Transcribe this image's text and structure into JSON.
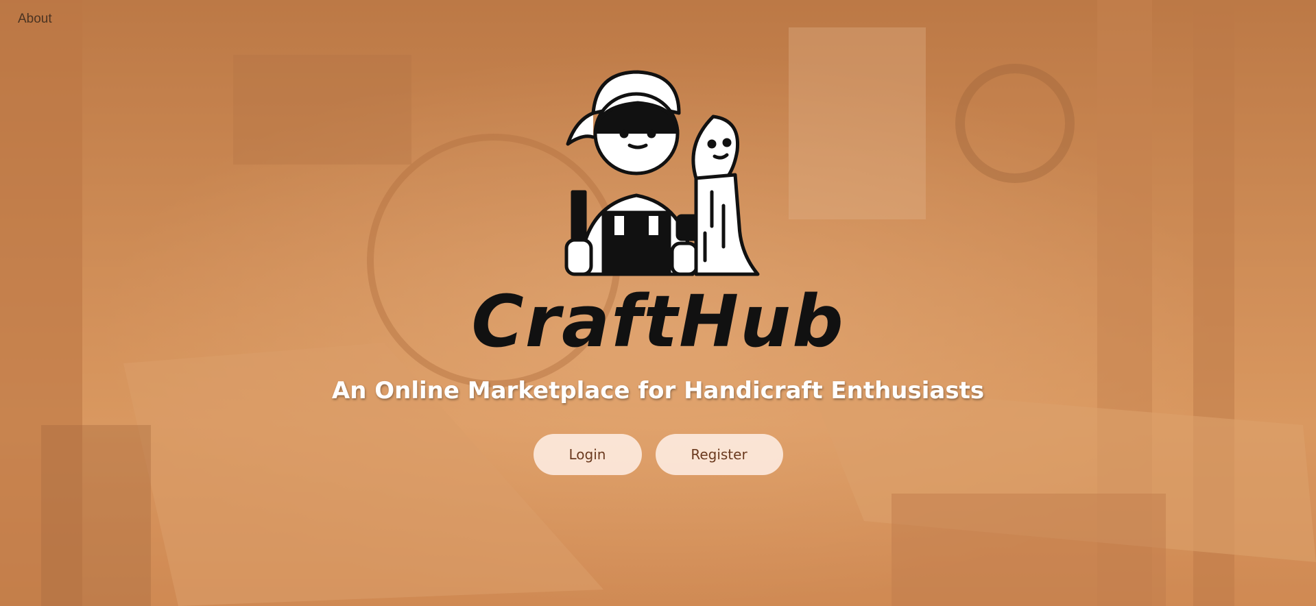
{
  "nav": {
    "about_label": "About"
  },
  "brand": {
    "name": "CraftHub",
    "logo_icon": "craftsman-icon"
  },
  "hero": {
    "tagline": "An Online Marketplace for Handicraft Enthusiasts"
  },
  "actions": {
    "login_label": "Login",
    "register_label": "Register"
  },
  "colors": {
    "overlay": "#e1965a",
    "button_bg": "#fff0e8",
    "button_text": "#6b3a1f",
    "tagline": "#ffffff"
  }
}
